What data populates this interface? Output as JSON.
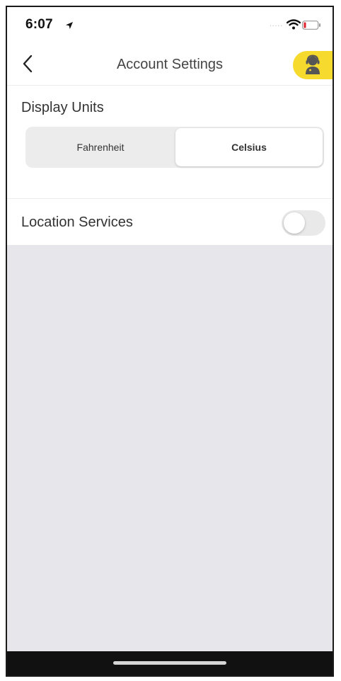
{
  "status_bar": {
    "time": "6:07",
    "signal": "....."
  },
  "header": {
    "title": "Account Settings"
  },
  "icons": {
    "back": "chevron-left-icon",
    "support": "support-agent-icon",
    "location_arrow": "location-arrow-icon",
    "wifi": "wifi-icon",
    "battery": "battery-icon"
  },
  "display_units": {
    "label": "Display Units",
    "options": [
      "Fahrenheit",
      "Celsius"
    ],
    "selected": "Celsius"
  },
  "location_services": {
    "label": "Location Services",
    "enabled": false
  },
  "colors": {
    "accent_yellow": "#f7da2e",
    "background_gray": "#e7e6ea",
    "battery_low": "#e0222a"
  }
}
